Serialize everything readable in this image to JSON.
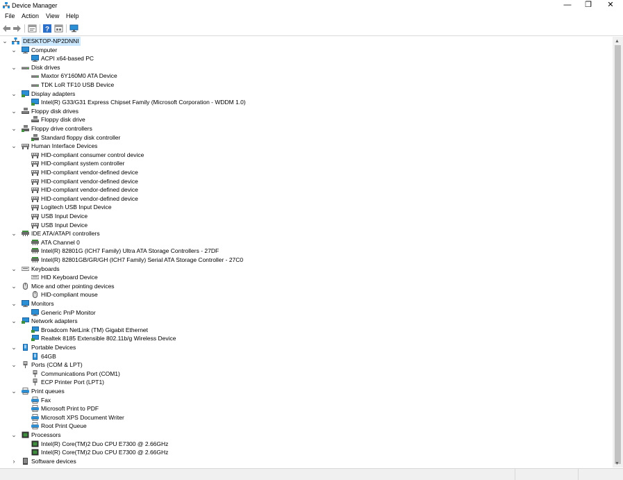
{
  "window": {
    "title": "Device Manager",
    "minimize": "—",
    "restore": "❐",
    "close": "✕"
  },
  "menu": [
    "File",
    "Action",
    "View",
    "Help"
  ],
  "toolbar_icons": [
    "back-arrow-icon",
    "forward-arrow-icon",
    "properties-icon",
    "help-icon",
    "update-driver-icon",
    "monitor-icon"
  ],
  "tree": [
    {
      "label": "DESKTOP-NP2DNNI",
      "level": 0,
      "expander": "open",
      "icon": "computer-root",
      "selected": true
    },
    {
      "label": "Computer",
      "level": 1,
      "expander": "open",
      "icon": "monitor"
    },
    {
      "label": "ACPI x64-based PC",
      "level": 2,
      "icon": "monitor"
    },
    {
      "label": "Disk drives",
      "level": 1,
      "expander": "open",
      "icon": "disk"
    },
    {
      "label": "Maxtor 6Y160M0 ATA Device",
      "level": 2,
      "icon": "disk"
    },
    {
      "label": "TDK LoR TF10 USB Device",
      "level": 2,
      "icon": "disk"
    },
    {
      "label": "Display adapters",
      "level": 1,
      "expander": "open",
      "icon": "display"
    },
    {
      "label": "Intel(R) G33/G31 Express Chipset Family (Microsoft Corporation - WDDM 1.0)",
      "level": 2,
      "icon": "display"
    },
    {
      "label": "Floppy disk drives",
      "level": 1,
      "expander": "open",
      "icon": "floppy"
    },
    {
      "label": "Floppy disk drive",
      "level": 2,
      "icon": "floppy"
    },
    {
      "label": "Floppy drive controllers",
      "level": 1,
      "expander": "open",
      "icon": "floppyctl"
    },
    {
      "label": "Standard floppy disk controller",
      "level": 2,
      "icon": "floppyctl"
    },
    {
      "label": "Human Interface Devices",
      "level": 1,
      "expander": "open",
      "icon": "hid"
    },
    {
      "label": "HID-compliant consumer control device",
      "level": 2,
      "icon": "hid"
    },
    {
      "label": "HID-compliant system controller",
      "level": 2,
      "icon": "hid"
    },
    {
      "label": "HID-compliant vendor-defined device",
      "level": 2,
      "icon": "hid"
    },
    {
      "label": "HID-compliant vendor-defined device",
      "level": 2,
      "icon": "hid"
    },
    {
      "label": "HID-compliant vendor-defined device",
      "level": 2,
      "icon": "hid"
    },
    {
      "label": "HID-compliant vendor-defined device",
      "level": 2,
      "icon": "hid"
    },
    {
      "label": "Logitech USB Input Device",
      "level": 2,
      "icon": "hid"
    },
    {
      "label": "USB Input Device",
      "level": 2,
      "icon": "hid"
    },
    {
      "label": "USB Input Device",
      "level": 2,
      "icon": "hid"
    },
    {
      "label": "IDE ATA/ATAPI controllers",
      "level": 1,
      "expander": "open",
      "icon": "ide"
    },
    {
      "label": "ATA Channel 0",
      "level": 2,
      "icon": "ide"
    },
    {
      "label": "Intel(R) 82801G (ICH7 Family) Ultra ATA Storage Controllers - 27DF",
      "level": 2,
      "icon": "ide"
    },
    {
      "label": "Intel(R) 82801GB/GR/GH (ICH7 Family) Serial ATA Storage Controller - 27C0",
      "level": 2,
      "icon": "ide"
    },
    {
      "label": "Keyboards",
      "level": 1,
      "expander": "open",
      "icon": "keyboard"
    },
    {
      "label": "HID Keyboard Device",
      "level": 2,
      "icon": "keyboard"
    },
    {
      "label": "Mice and other pointing devices",
      "level": 1,
      "expander": "open",
      "icon": "mouse"
    },
    {
      "label": "HID-compliant mouse",
      "level": 2,
      "icon": "mouse"
    },
    {
      "label": "Monitors",
      "level": 1,
      "expander": "open",
      "icon": "monitor"
    },
    {
      "label": "Generic PnP Monitor",
      "level": 2,
      "icon": "monitor"
    },
    {
      "label": "Network adapters",
      "level": 1,
      "expander": "open",
      "icon": "network"
    },
    {
      "label": "Broadcom NetLink (TM) Gigabit Ethernet",
      "level": 2,
      "icon": "network"
    },
    {
      "label": "Realtek 8185 Extensible 802.11b/g Wireless Device",
      "level": 2,
      "icon": "network"
    },
    {
      "label": "Portable Devices",
      "level": 1,
      "expander": "open",
      "icon": "portable"
    },
    {
      "label": "64GB",
      "level": 2,
      "icon": "portable"
    },
    {
      "label": "Ports (COM & LPT)",
      "level": 1,
      "expander": "open",
      "icon": "port"
    },
    {
      "label": "Communications Port (COM1)",
      "level": 2,
      "icon": "port"
    },
    {
      "label": "ECP Printer Port (LPT1)",
      "level": 2,
      "icon": "port"
    },
    {
      "label": "Print queues",
      "level": 1,
      "expander": "open",
      "icon": "printer"
    },
    {
      "label": "Fax",
      "level": 2,
      "icon": "printer"
    },
    {
      "label": "Microsoft Print to PDF",
      "level": 2,
      "icon": "printer"
    },
    {
      "label": "Microsoft XPS Document Writer",
      "level": 2,
      "icon": "printer"
    },
    {
      "label": "Root Print Queue",
      "level": 2,
      "icon": "printer"
    },
    {
      "label": "Processors",
      "level": 1,
      "expander": "open",
      "icon": "cpu"
    },
    {
      "label": "Intel(R) Core(TM)2 Duo CPU     E7300  @ 2.66GHz",
      "level": 2,
      "icon": "cpu"
    },
    {
      "label": "Intel(R) Core(TM)2 Duo CPU     E7300  @ 2.66GHz",
      "level": 2,
      "icon": "cpu"
    },
    {
      "label": "Software devices",
      "level": 1,
      "expander": "closed",
      "icon": "software"
    }
  ],
  "colors": {
    "selection": "#cce8ff",
    "icon_blue": "#2b8fd6",
    "icon_gray": "#6d6d6d",
    "icon_green": "#3f8f3f"
  }
}
